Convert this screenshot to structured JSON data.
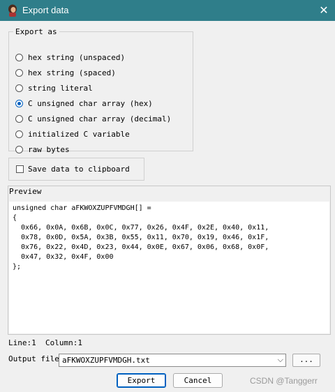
{
  "window": {
    "title": "Export data",
    "close_glyph": "✕"
  },
  "export_as": {
    "legend": "Export as",
    "options": [
      {
        "label": "hex string (unspaced)",
        "checked": false
      },
      {
        "label": "hex string (spaced)",
        "checked": false
      },
      {
        "label": "string literal",
        "checked": false
      },
      {
        "label": "C unsigned char array (hex)",
        "checked": true
      },
      {
        "label": "C unsigned char array (decimal)",
        "checked": false
      },
      {
        "label": "initialized C variable",
        "checked": false
      },
      {
        "label": "raw bytes",
        "checked": false
      }
    ]
  },
  "clipboard": {
    "label": "Save data to clipboard",
    "checked": false
  },
  "preview": {
    "label": "Preview",
    "text": "unsigned char aFKWOXZUPFVMDGH[] =\n{\n  0x66, 0x0A, 0x6B, 0x0C, 0x77, 0x26, 0x4F, 0x2E, 0x40, 0x11,\n  0x78, 0x0D, 0x5A, 0x3B, 0x55, 0x11, 0x70, 0x19, 0x46, 0x1F,\n  0x76, 0x22, 0x4D, 0x23, 0x44, 0x0E, 0x67, 0x06, 0x68, 0x0F,\n  0x47, 0x32, 0x4F, 0x00\n};"
  },
  "status": "Line:1  Column:1",
  "output": {
    "label": "Output file",
    "value": "aFKWOXZUPFVMDGH.txt",
    "browse_label": "..."
  },
  "buttons": {
    "export": "Export",
    "cancel": "Cancel"
  },
  "watermark": "CSDN @Tanggerr",
  "colors": {
    "titlebar": "#2f7e8a",
    "accent": "#0060c0"
  }
}
